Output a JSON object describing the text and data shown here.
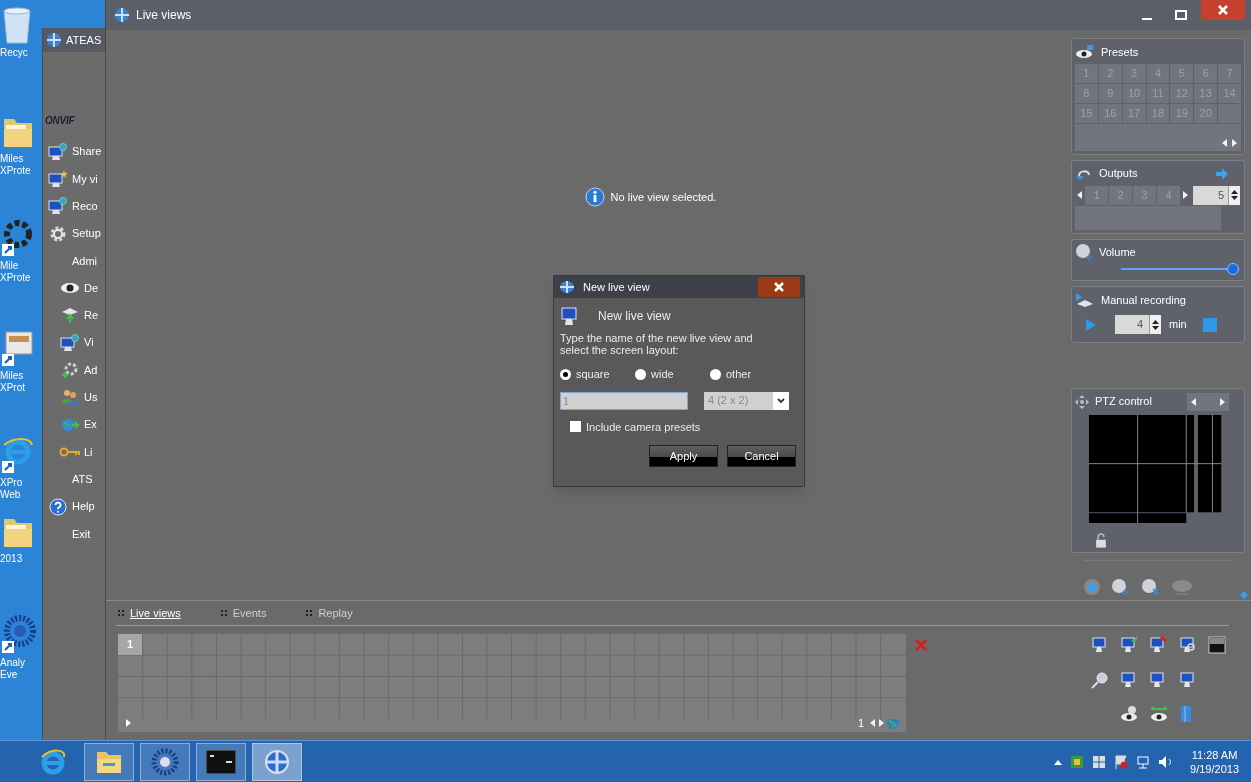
{
  "desktop_icons": [
    {
      "kind": "recycle",
      "lines": [
        "Recyc"
      ]
    },
    {
      "kind": "folder",
      "lines": [
        "Miles",
        "XProte"
      ]
    },
    {
      "kind": "gear_app",
      "lines": [
        "Mile",
        "XProte"
      ]
    },
    {
      "kind": "window_app",
      "lines": [
        "Miles",
        "XProt"
      ]
    },
    {
      "kind": "browser",
      "lines": [
        "XPro",
        "Web"
      ]
    },
    {
      "kind": "folder",
      "lines": [
        "2013"
      ]
    },
    {
      "kind": "logo_app",
      "lines": [
        "Analy",
        "Eve"
      ]
    }
  ],
  "launcher_window": {
    "title": "ATEAS",
    "logo": "ONVIF",
    "menu": [
      {
        "label": "Share",
        "kind": "monitor_globe"
      },
      {
        "label": "My vi",
        "kind": "monitor_star"
      },
      {
        "label": "Reco",
        "kind": "monitor_globe"
      },
      {
        "label": "Setup",
        "kind": "gear"
      },
      {
        "label": "Admi",
        "kind": "none",
        "children": [
          {
            "label": "De",
            "kind": "camera"
          },
          {
            "label": "Re",
            "kind": "tray"
          },
          {
            "label": "Vi",
            "kind": "monitor_globe"
          },
          {
            "label": "Ad",
            "kind": "gear_plus"
          },
          {
            "label": "Us",
            "kind": "users"
          },
          {
            "label": "Ex",
            "kind": "globe_arrow"
          },
          {
            "label": "Li",
            "kind": "key"
          }
        ]
      },
      {
        "label": "ATS",
        "kind": "none"
      },
      {
        "label": "Help",
        "kind": "help"
      },
      {
        "label": "Exit",
        "kind": "none"
      }
    ]
  },
  "main_window": {
    "title": "Live views",
    "message": "No live view selected.",
    "presets": {
      "title": "Presets",
      "buttons": [
        "1",
        "2",
        "3",
        "4",
        "5",
        "6",
        "7",
        "8",
        "9",
        "10",
        "11",
        "12",
        "13",
        "14",
        "15",
        "16",
        "17",
        "18",
        "19",
        "20"
      ]
    },
    "outputs": {
      "title": "Outputs",
      "buttons": [
        "1",
        "2",
        "3",
        "4"
      ],
      "value": "5"
    },
    "volume": {
      "title": "Volume",
      "level": 1.0
    },
    "manual_recording": {
      "title": "Manual recording",
      "minutes": "4",
      "unit": "min"
    },
    "ptz": {
      "title": "PTZ control"
    },
    "tabs": [
      {
        "label": "Live views",
        "selected": true
      },
      {
        "label": "Events",
        "selected": false
      },
      {
        "label": "Replay",
        "selected": false
      }
    ],
    "layout_grid": {
      "first_cell": "1",
      "page": "1"
    }
  },
  "dialog": {
    "title": "New live view",
    "heading": "New live view",
    "instruction": "Type the name of the new live view and select the screen layout:",
    "layouts": [
      {
        "label": "square",
        "selected": true
      },
      {
        "label": "wide",
        "selected": false
      },
      {
        "label": "other",
        "selected": false
      }
    ],
    "name_value": "1",
    "layout_value": "4 (2 x 2)",
    "include_presets": {
      "label": "Include camera presets",
      "checked": false
    },
    "buttons": [
      "Apply",
      "Cancel"
    ]
  },
  "taskbar": {
    "apps": [
      {
        "kind": "browser",
        "running": false,
        "selected": false
      },
      {
        "kind": "explorer",
        "running": true,
        "selected": false
      },
      {
        "kind": "logo_app",
        "running": true,
        "selected": false
      },
      {
        "kind": "console",
        "running": true,
        "selected": false
      },
      {
        "kind": "globe_app",
        "running": true,
        "selected": true
      }
    ],
    "time": "11:28 AM",
    "date": "9/19/2013"
  }
}
